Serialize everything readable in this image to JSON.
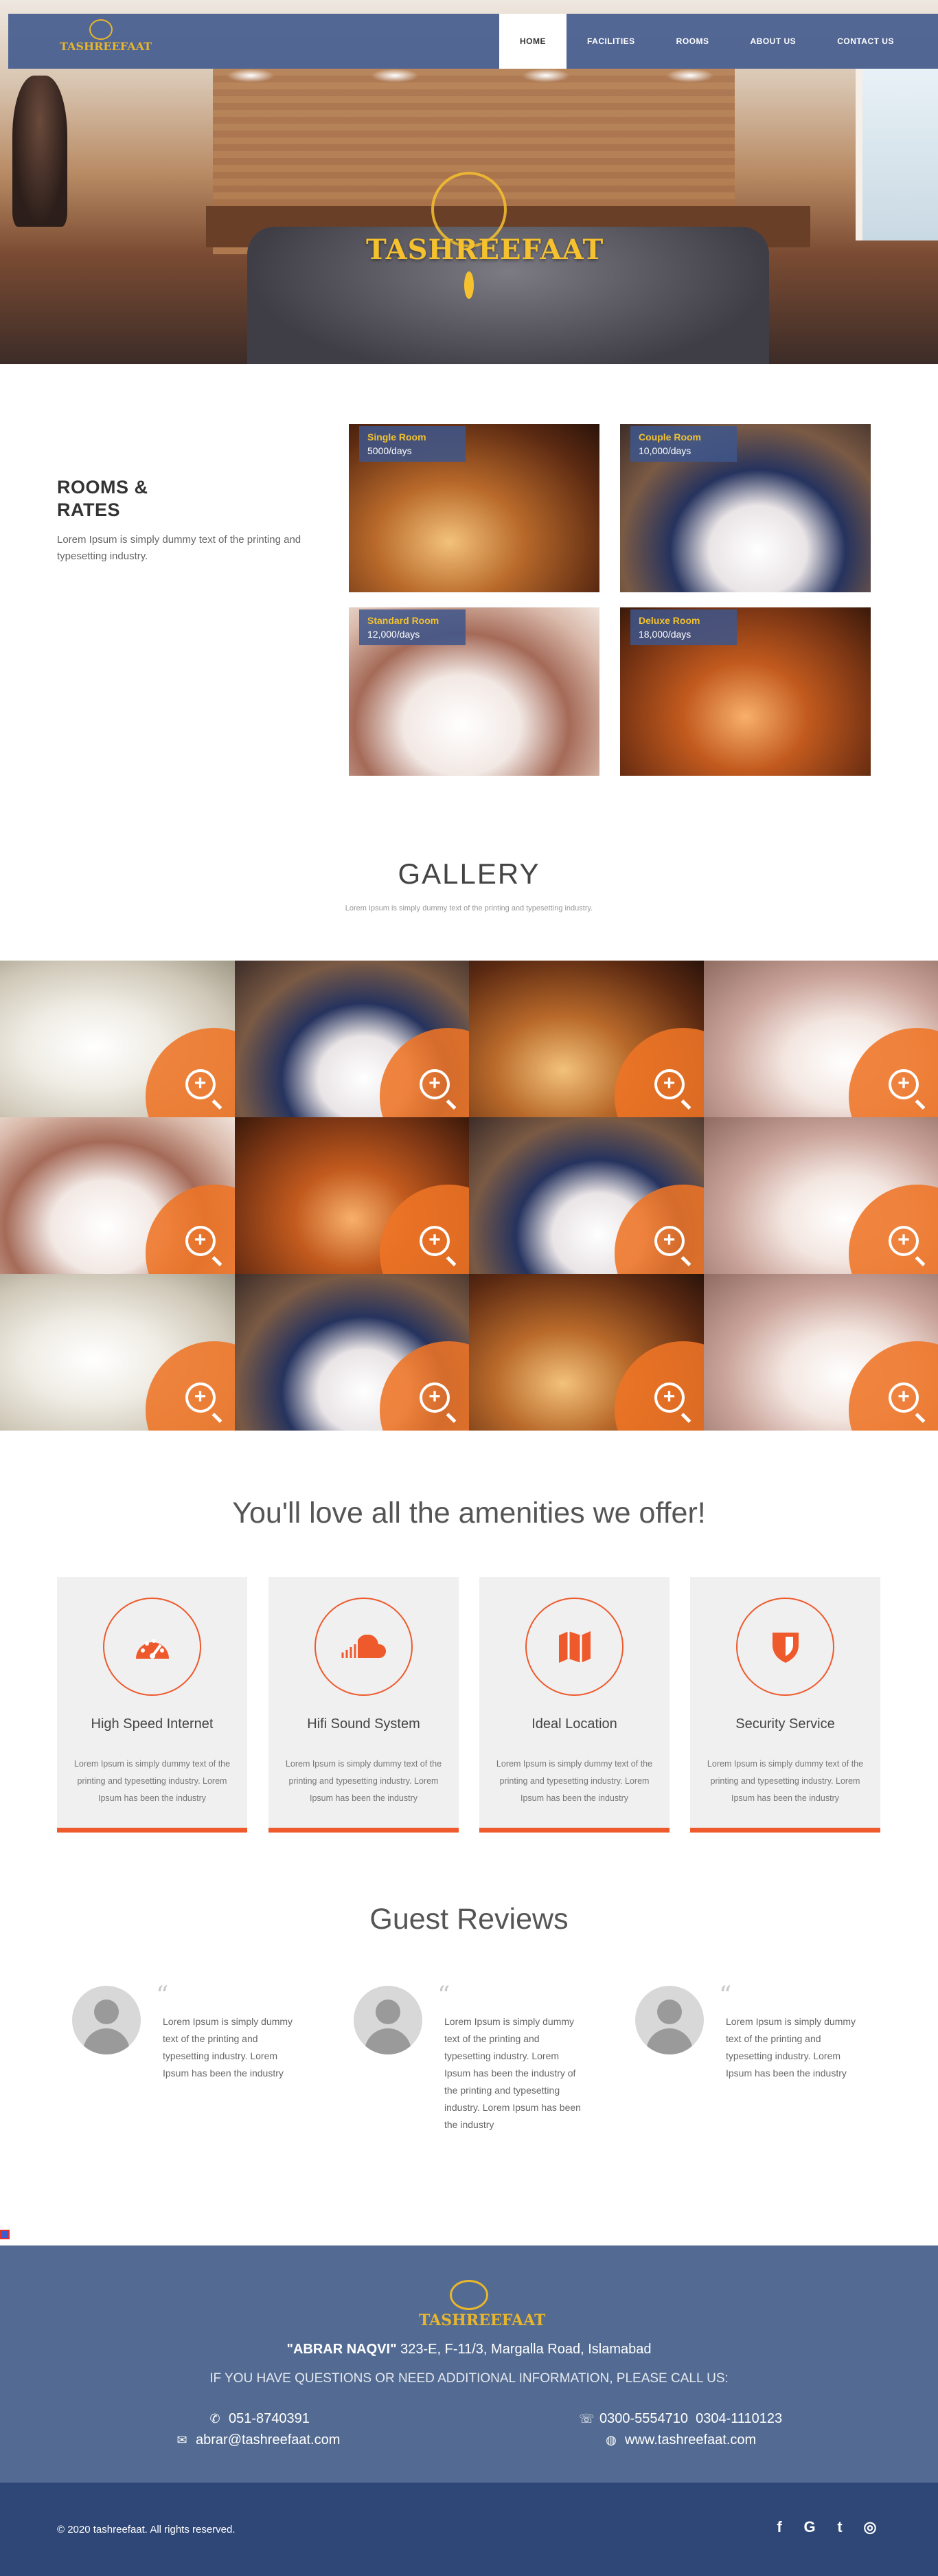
{
  "brand": {
    "name": "TASHREEFAAT"
  },
  "nav": {
    "items": [
      {
        "label": "HOME",
        "active": true
      },
      {
        "label": "FACILITIES",
        "active": false
      },
      {
        "label": "ROOMS",
        "active": false
      },
      {
        "label": "ABOUT US",
        "active": false
      },
      {
        "label": "CONTACT US",
        "active": false
      }
    ]
  },
  "hero": {
    "logo_text": "TASHREEFAAT"
  },
  "rooms": {
    "heading_line1": "ROOMS &",
    "heading_line2": "RATES",
    "description": "Lorem Ipsum is simply dummy text of the printing and typesetting industry.",
    "cards": [
      {
        "name": "Single Room",
        "rate": "5000/days"
      },
      {
        "name": "Couple Room",
        "rate": "10,000/days"
      },
      {
        "name": "Standard Room",
        "rate": "12,000/days"
      },
      {
        "name": "Deluxe Room",
        "rate": "18,000/days"
      }
    ]
  },
  "gallery": {
    "title": "GALLERY",
    "subtitle": "Lorem Ipsum is simply dummy text of the printing and typesetting industry."
  },
  "amenities": {
    "title": "You'll love all the amenities we offer!",
    "items": [
      {
        "icon": "speedometer-icon",
        "name": "High Speed Internet",
        "description": "Lorem Ipsum is simply dummy text of the printing and typesetting industry. Lorem Ipsum has been the industry"
      },
      {
        "icon": "soundcloud-icon",
        "name": "Hifi Sound System",
        "description": "Lorem Ipsum is simply dummy text of the printing and typesetting industry. Lorem Ipsum has been the industry"
      },
      {
        "icon": "map-icon",
        "name": "Ideal Location",
        "description": "Lorem Ipsum is simply dummy text of the printing and typesetting industry. Lorem Ipsum has been the industry"
      },
      {
        "icon": "shield-icon",
        "name": "Security Service",
        "description": "Lorem Ipsum is simply dummy text of the printing and typesetting industry. Lorem Ipsum has been the industry"
      }
    ]
  },
  "reviews": {
    "title": "Guest Reviews",
    "items": [
      {
        "text": "Lorem Ipsum is simply dummy text of the printing and typesetting industry. Lorem Ipsum has been the industry"
      },
      {
        "text": "Lorem Ipsum is simply dummy text of the printing and typesetting industry. Lorem Ipsum has been the industry of the printing and typesetting industry. Lorem Ipsum has been the industry"
      },
      {
        "text": "Lorem Ipsum is simply dummy text of the printing and typesetting industry. Lorem Ipsum has been the industry"
      }
    ]
  },
  "footer": {
    "logo_text": "TASHREEFAAT",
    "owner": "\"ABRAR NAQVI\"",
    "address": "323-E, F-11/3, Margalla Road, Islamabad",
    "cta": "IF YOU HAVE QUESTIONS OR NEED ADDITIONAL INFORMATION, PLEASE CALL US:",
    "phone": "051-8740391",
    "email": "abrar@tashreefaat.com",
    "whatsapp": "0300-5554710  0304-1110123",
    "website": "www.tashreefaat.com",
    "copyright": "© 2020 tashreefaat. All rights reserved.",
    "social": [
      {
        "icon": "facebook-icon",
        "glyph": "f"
      },
      {
        "icon": "google-icon",
        "glyph": "G"
      },
      {
        "icon": "twitter-icon",
        "glyph": "t"
      },
      {
        "icon": "instagram-icon",
        "glyph": "◎"
      }
    ]
  },
  "colors": {
    "nav_bg": "#3d568c",
    "gold": "#f2c230",
    "accent_orange": "#ee5a2c",
    "footer_bg": "#536b92",
    "footer_bottom_bg": "#2f4776"
  }
}
